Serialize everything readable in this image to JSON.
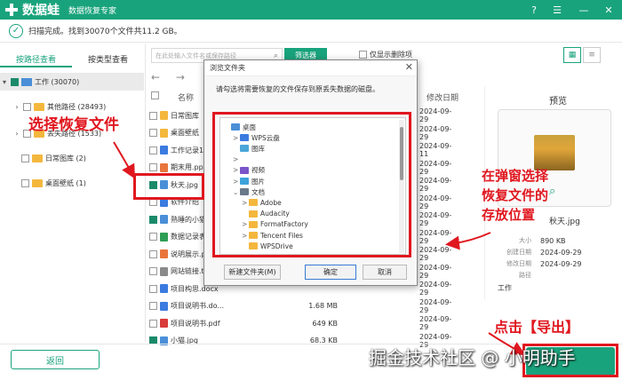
{
  "app": {
    "brand": "数据蛙",
    "subtitle": "数据恢复专家"
  },
  "status": {
    "text": "扫描完成。找到30070个文件共11.2 GB。"
  },
  "tabs": {
    "by_path": "按路径查看",
    "by_type": "按类型查看"
  },
  "search": {
    "placeholder": "在此处输入文件名或保存路径"
  },
  "filter_label": "筛选器",
  "only_deleted_label": "仅显示删除项",
  "tree": {
    "root": "工作 (30070)",
    "items": [
      {
        "label": "其他路径 (28493)"
      },
      {
        "label": "丢失路径 (1533)"
      },
      {
        "label": "日常图库 (2)"
      },
      {
        "label": "桌面壁纸 (1)"
      }
    ]
  },
  "columns": {
    "name": "名称",
    "modified": "修改日期"
  },
  "files": [
    {
      "name": "日常图库",
      "size": "",
      "date": "2024-09-29",
      "icon": "folder",
      "checked": false
    },
    {
      "name": "桌面壁纸",
      "size": "",
      "date": "2024-09-29",
      "icon": "folder",
      "checked": false
    },
    {
      "name": "工作记录1",
      "size": "",
      "date": "2024-09-11",
      "icon": "doc",
      "checked": false
    },
    {
      "name": "期末用.ppt",
      "size": "",
      "date": "2024-09-29",
      "icon": "ppt",
      "checked": false
    },
    {
      "name": "秋天.jpg",
      "size": "",
      "date": "2024-09-29",
      "icon": "img",
      "checked": true
    },
    {
      "name": "软件介绍",
      "size": "",
      "date": "2024-09-29",
      "icon": "doc",
      "checked": false
    },
    {
      "name": "熟睡的小猫",
      "size": "",
      "date": "2024-09-29",
      "icon": "img",
      "checked": true
    },
    {
      "name": "数据记录表",
      "size": "",
      "date": "2024-09-29",
      "icon": "xls",
      "checked": false
    },
    {
      "name": "说明展示.p",
      "size": "",
      "date": "2024-09-29",
      "icon": "ppt",
      "checked": false
    },
    {
      "name": "网站链接.t",
      "size": "",
      "date": "2024-09-29",
      "icon": "txt",
      "checked": false
    },
    {
      "name": "项目构思.docx",
      "size": "",
      "date": "2024-09-29",
      "icon": "doc",
      "checked": false
    },
    {
      "name": "项目说明书.do...",
      "size": "1.68 MB",
      "date": "2024-09-29",
      "icon": "doc",
      "checked": false
    },
    {
      "name": "项目说明书.pdf",
      "size": "649 KB",
      "date": "2024-09-29",
      "icon": "pdf",
      "checked": false
    },
    {
      "name": "小猫.jpg",
      "size": "68.3 KB",
      "date": "2024-09-29",
      "icon": "img",
      "checked": true
    }
  ],
  "dialog": {
    "title": "浏览文件夹",
    "description": "请勾选将需要恢复的文件保存到原丢失数据的磁盘。",
    "tree": [
      {
        "label": "桌面",
        "level": 0,
        "arrow": "",
        "icon": "desktop"
      },
      {
        "label": "WPS云盘",
        "level": 1,
        "arrow": ">",
        "icon": "cloud"
      },
      {
        "label": "图库",
        "level": 1,
        "arrow": "",
        "icon": "gallery"
      },
      {
        "label": "",
        "level": 1,
        "arrow": ">",
        "icon": ""
      },
      {
        "label": "视频",
        "level": 1,
        "arrow": ">",
        "icon": "video"
      },
      {
        "label": "图片",
        "level": 1,
        "arrow": ">",
        "icon": "picture"
      },
      {
        "label": "文档",
        "level": 1,
        "arrow": "v",
        "icon": "docs"
      },
      {
        "label": "Adobe",
        "level": 2,
        "arrow": ">",
        "icon": "folder"
      },
      {
        "label": "Audacity",
        "level": 2,
        "arrow": "",
        "icon": "folder"
      },
      {
        "label": "FormatFactory",
        "level": 2,
        "arrow": ">",
        "icon": "folder"
      },
      {
        "label": "Tencent Files",
        "level": 2,
        "arrow": ">",
        "icon": "folder"
      },
      {
        "label": "WPSDrive",
        "level": 2,
        "arrow": "",
        "icon": "folder"
      }
    ],
    "new_folder": "新建文件夹(M)",
    "ok": "确定",
    "cancel": "取消"
  },
  "preview": {
    "title": "预览",
    "filename": "秋天.jpg",
    "size_label": "大小",
    "size": "890 KB",
    "created_label": "创建日期",
    "created": "2024-09-29",
    "modified_label": "修改日期",
    "modified": "2024-09-29",
    "path_label": "路径",
    "path": "工作"
  },
  "annotations": {
    "select_file": "选择恢复文件",
    "choose_location": [
      "在弹窗选择",
      "恢复文件的",
      "存放位置"
    ],
    "click_export": "点击【导出】"
  },
  "back_label": "返回",
  "watermark": "掘金技术社区 @ 小明助手",
  "colors": {
    "accent": "#19a37c",
    "annotation": "#e0171f"
  }
}
